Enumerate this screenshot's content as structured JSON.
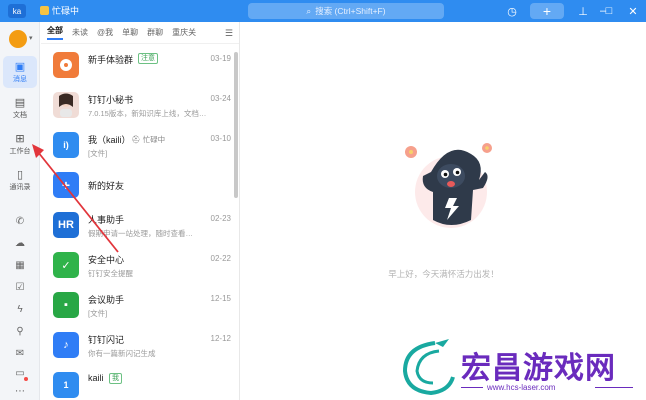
{
  "titlebar": {
    "avatar_text": "ka",
    "status": "忙碌中",
    "search_placeholder": "搜索 (Ctrl+Shift+F)",
    "icons": [
      "history-icon",
      "plus-icon",
      "pin-icon",
      "minimize-icon",
      "maximize-icon",
      "close-icon"
    ]
  },
  "rail": {
    "items": [
      {
        "label": "消息",
        "icon": "message-icon",
        "active": true
      },
      {
        "label": "文档",
        "icon": "document-icon",
        "active": false
      },
      {
        "label": "工作台",
        "icon": "workbench-icon",
        "active": false
      },
      {
        "label": "通讯录",
        "icon": "contacts-icon",
        "active": false
      }
    ],
    "small_icons": [
      "phone-icon",
      "cloud-icon",
      "calendar-icon",
      "todo-icon",
      "lightning-icon",
      "link-icon",
      "mail-icon",
      "note-icon",
      "more-icon"
    ]
  },
  "tabs": [
    "全部",
    "未读",
    "@我",
    "单聊",
    "群聊",
    "重庆关"
  ],
  "chats": [
    {
      "name": "新手体验群",
      "tag": "注意",
      "sub": "",
      "time": "03-19",
      "avatar_color": "#f07b3a",
      "avatar_text": ""
    },
    {
      "name": "钉钉小秘书",
      "tag": "",
      "sub": "7.0.15版本，新知识库上线，文档…",
      "time": "03-24",
      "avatar_color": "#e9cfc6",
      "avatar_text": ""
    },
    {
      "name": "我（kaili）",
      "tag": "",
      "sub": "[文件]",
      "time": "03-10",
      "avatar_color": "#2f8cf0",
      "avatar_text": "i)",
      "busy": "忙碌中"
    },
    {
      "name": "新的好友",
      "tag": "",
      "sub": "",
      "time": "",
      "avatar_color": "#2f7df6",
      "avatar_text": "+"
    },
    {
      "name": "人事助手",
      "tag": "",
      "sub": "假期申请一站处理，随时查看…",
      "time": "02-23",
      "avatar_color": "#1e6fd6",
      "avatar_text": "HR"
    },
    {
      "name": "安全中心",
      "tag": "",
      "sub": "钉钉安全提醒",
      "time": "02-22",
      "avatar_color": "#2fb34a",
      "avatar_text": "✓"
    },
    {
      "name": "会议助手",
      "tag": "",
      "sub": "[文件]",
      "time": "12-15",
      "avatar_color": "#28a745",
      "avatar_text": "▪"
    },
    {
      "name": "钉钉闪记",
      "tag": "",
      "sub": "你有一篇新闪记生成",
      "time": "12-12",
      "avatar_color": "#2f7df6",
      "avatar_text": "♪"
    },
    {
      "name": "kaili",
      "tag": "我",
      "sub": "",
      "time": "",
      "avatar_color": "#2f8cf0",
      "avatar_text": "1"
    }
  ],
  "main": {
    "greeting": "早上好，今天满怀活力出发！"
  },
  "watermark": {
    "title": "宏昌游戏网",
    "url": "www.hcs-laser.com"
  },
  "colors": {
    "brand": "#2f8cf0",
    "annotation_arrow": "#e2353b",
    "watermark": "#6a2bbd"
  }
}
